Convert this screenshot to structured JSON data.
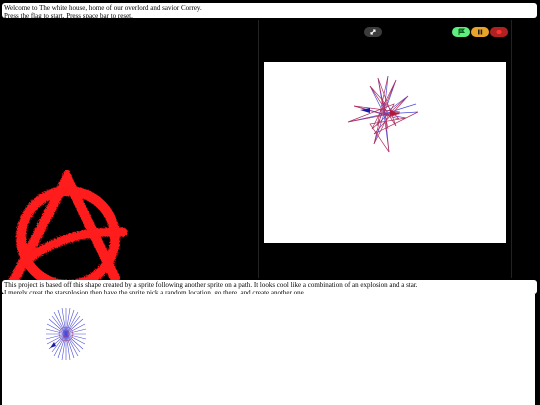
{
  "header": {
    "line1": "Welcome to The white house, home of our overlord and savior Correy.",
    "line2": "Press the flag to start. Press space bar to reset."
  },
  "player": {
    "controls": {
      "fullscreen": "fullscreen-icon",
      "green_flag": "green-flag-icon",
      "pause": "pause-icon",
      "stop": "stop-icon"
    },
    "colors": {
      "flag": "#5ef07e",
      "pause": "#e8a52a",
      "stop": "#b02222"
    }
  },
  "description": {
    "line1": "This project is based off this shape created by a sprite following another sprite on a path. It looks cool like a combination of an explosion and a star.",
    "line2": "I merely creat the starsplosion then have the sprite pick a random location, go there, and create another one."
  },
  "images": {
    "left": "anarchy-symbol-icon",
    "stage": "starsplosion-icon",
    "description": "starsplosion-icon"
  }
}
